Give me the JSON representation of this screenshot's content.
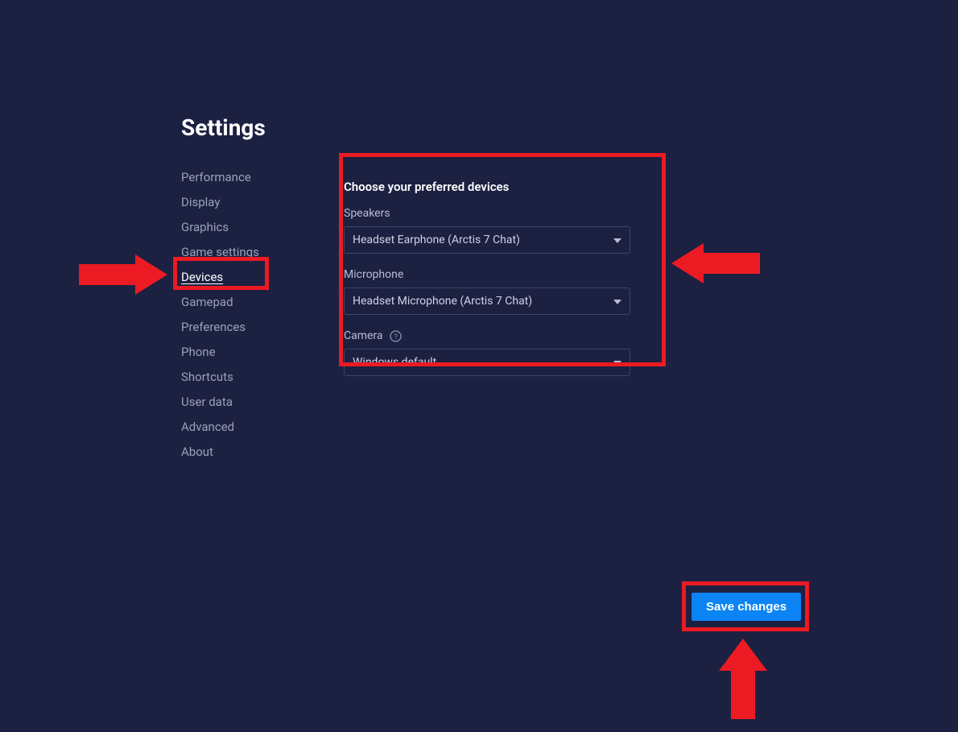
{
  "page_title": "Settings",
  "sidebar": {
    "items": [
      {
        "label": "Performance",
        "active": false
      },
      {
        "label": "Display",
        "active": false
      },
      {
        "label": "Graphics",
        "active": false
      },
      {
        "label": "Game settings",
        "active": false
      },
      {
        "label": "Devices",
        "active": true
      },
      {
        "label": "Gamepad",
        "active": false
      },
      {
        "label": "Preferences",
        "active": false
      },
      {
        "label": "Phone",
        "active": false
      },
      {
        "label": "Shortcuts",
        "active": false
      },
      {
        "label": "User data",
        "active": false
      },
      {
        "label": "Advanced",
        "active": false
      },
      {
        "label": "About",
        "active": false
      }
    ]
  },
  "content": {
    "section_title": "Choose your preferred devices",
    "speakers": {
      "label": "Speakers",
      "value": "Headset Earphone (Arctis 7 Chat)"
    },
    "microphone": {
      "label": "Microphone",
      "value": "Headset Microphone (Arctis 7 Chat)"
    },
    "camera": {
      "label": "Camera",
      "value": "Windows default"
    }
  },
  "footer": {
    "save_label": "Save changes"
  }
}
